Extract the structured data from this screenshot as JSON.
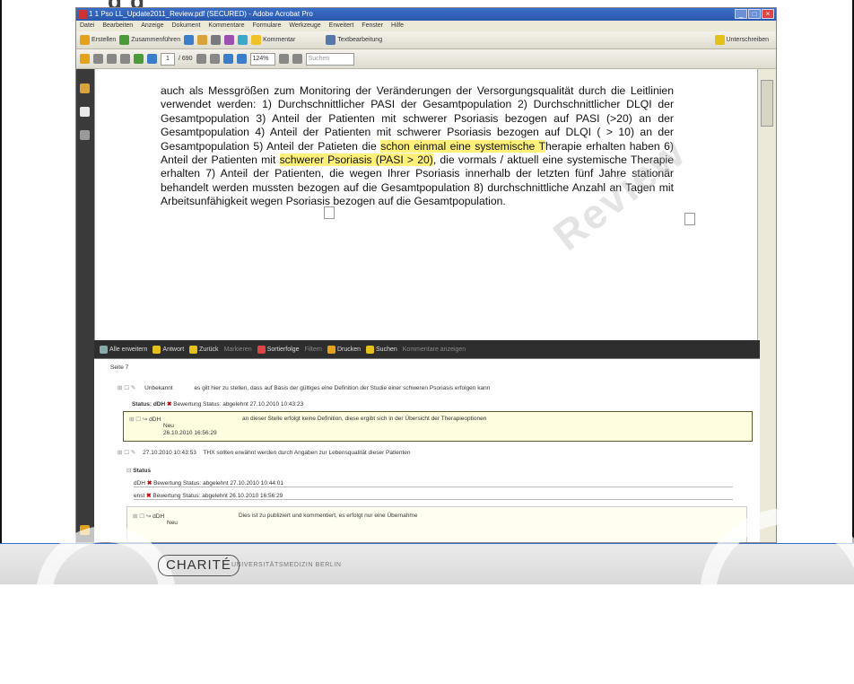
{
  "slide": {
    "title_partial": "g                                             g"
  },
  "window": {
    "title": "1 1 Pso LL_Update2011_Review.pdf (SECURED) - Adobe Acrobat Pro",
    "controls": [
      "_",
      "□",
      "×"
    ]
  },
  "menu": [
    "Datei",
    "Bearbeiten",
    "Anzeige",
    "Dokument",
    "Kommentare",
    "Formulare",
    "Werkzeuge",
    "Erweitert",
    "Fenster",
    "Hilfe"
  ],
  "toolbar1": {
    "create": "Erstellen",
    "combine": "Zusammenführen",
    "comment": "Kommentar",
    "text_edit": "Textbearbeitung",
    "sign": "Unterschreiben"
  },
  "toolbar2": {
    "page_current": "1",
    "page_total": "/ 690",
    "zoom": "124%",
    "search_placeholder": "Suchen"
  },
  "document": {
    "text_before": "auch als Messgrößen zum Monitoring der Veränderungen der Versorgungsqualität durch die Leitlinien verwendet werden: 1) Durchschnittlicher PASI der Gesamtpopulation 2) Durchschnittlicher DLQI der Gesamtpopulation 3) Anteil der Patienten mit schwerer Psoriasis bezogen auf PASI (>20) an der Gesamtpopulation 4) Anteil der Patienten mit schwerer Psoriasis bezogen auf DLQI ( > 10) an der Gesamtpopulation 5) Anteil der Patieten die ",
    "highlight1": "schon einmal eine systemische T",
    "text_mid1": "herapie erhalten haben 6) Anteil der Patienten mit ",
    "highlight2": "schwerer Psoriasis (PASI > 20)",
    "text_after": ", die vormals / aktuell eine systemische Therapie erhalten 7) Anteil der Patienten, die wegen Ihrer Psoriasis innerhalb der letzten fünf Jahre stationär behandelt werden mussten bezogen auf die Gesamtpopulation 8) durchschnittliche Anzahl an Tagen mit Arbeitsunfähigkeit wegen Psoriasis bezogen auf die Gesamtpopulation.",
    "watermark": "Review"
  },
  "comment_toolbar": {
    "items": [
      "Alle erweitern",
      "Antwort",
      "Zurück",
      "Markieren",
      "Sortierfolge",
      "Filtern",
      "Drucken",
      "Suchen",
      "Kommentare anzeigen"
    ]
  },
  "comments": {
    "page_header": "Seite 7",
    "c1_author": "Unbekannt",
    "c1_text": "es gilt hier zu stellen, dass auf Basis der gültiges eine Definition der Studie einer schweren Psoriasis erfolgen kann",
    "status_label": "Status: dDH",
    "status_text": "Bewertung Status: abgelehnt 27.10.2010 10:43:23",
    "reply1_author": "dDH",
    "reply1_meta": "Neu",
    "reply1_date": "26.10.2010 16:56:29",
    "reply1_text": "an dieser Stelle erfolgt keine Definition, diese ergibt sich in der Übersicht der Therapieoptionen",
    "c2_date": "27.10.2010 10:43:53",
    "c2_text": "THX sollten erwähnt werden durch Angaben zur Lebensqualität dieser Patienten",
    "status_header": "Status",
    "status_line1_author": "dDH",
    "status_line1": "Bewertung Status: abgelehnt 27.10.2010 10:44:01",
    "status_line2_author": "enst",
    "status_line2": "Bewertung Status: abgelehnt 26.10.2010 16:56:29",
    "reply2_author": "dDH",
    "reply2_meta": "Neu",
    "reply2_text": "Dies ist zu publiziert und kommentiert, es erfolgt nur eine Übernahme"
  },
  "footer": {
    "logo": "CHARITÉ",
    "logo_sub": "UNIVERSITÄTSMEDIZIN BERLIN"
  },
  "colors": {
    "titlebar": "#2a57ad",
    "highlight": "#fff07a",
    "comment_box": "#fffde0",
    "footer_line": "#3b6fc9"
  }
}
